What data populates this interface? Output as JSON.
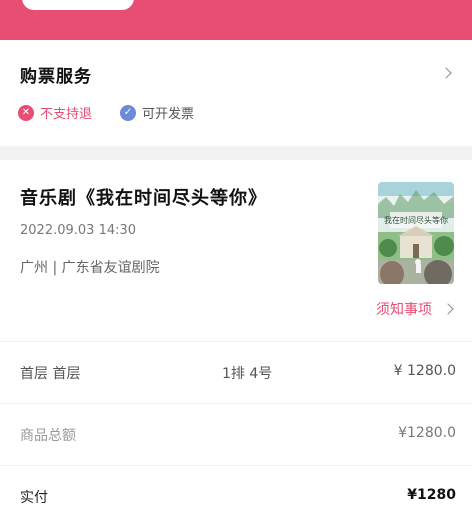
{
  "colors": {
    "accent": "#e84d74",
    "check": "#6d8ad8"
  },
  "purchase_service": {
    "title": "购票服务",
    "badges": [
      {
        "icon": "x-circle-icon",
        "label": "不支持退"
      },
      {
        "icon": "check-circle-icon",
        "label": "可开发票"
      }
    ]
  },
  "show": {
    "title": "音乐剧《我在时间尽头等你》",
    "datetime": "2022.09.03 14:30",
    "venue": "广州 | 广东省友谊剧院",
    "poster_text": "我在时间尽头等你",
    "notice_label": "须知事项"
  },
  "order": {
    "ticket": {
      "area": "首层 首层",
      "seat": "1排 4号",
      "price": "¥ 1280.0"
    },
    "total": {
      "label": "商品总额",
      "value": "¥1280.0"
    },
    "paid": {
      "label": "实付",
      "value": "¥1280"
    }
  }
}
